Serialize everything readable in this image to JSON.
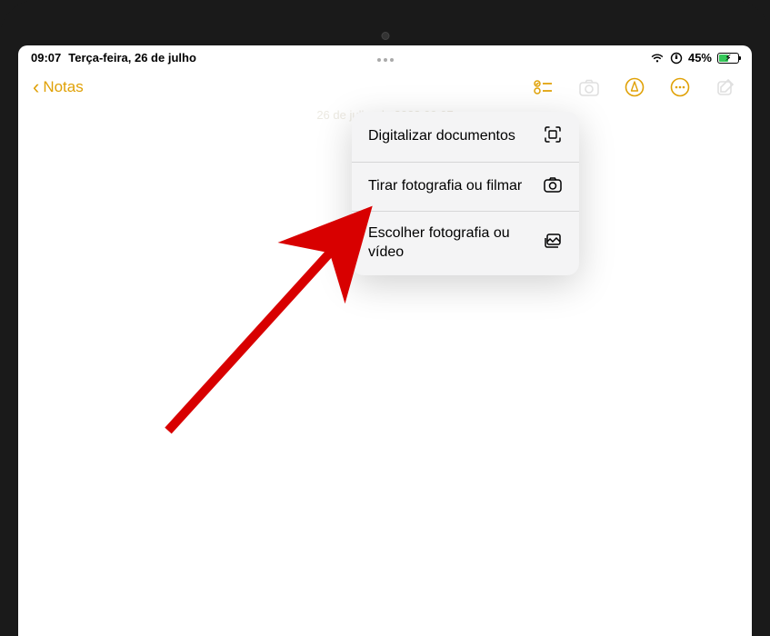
{
  "status": {
    "time": "09:07",
    "date": "Terça-feira, 26 de julho",
    "battery_percent": "45%"
  },
  "nav": {
    "back_label": "Notas"
  },
  "note": {
    "faint_timestamp": "26 de julho de 2022 09:07"
  },
  "popover": {
    "items": [
      {
        "label": "Digitalizar documentos",
        "icon": "scan"
      },
      {
        "label": "Tirar fotografia ou filmar",
        "icon": "camera"
      },
      {
        "label": "Escolher fotografia ou vídeo",
        "icon": "gallery"
      }
    ]
  }
}
